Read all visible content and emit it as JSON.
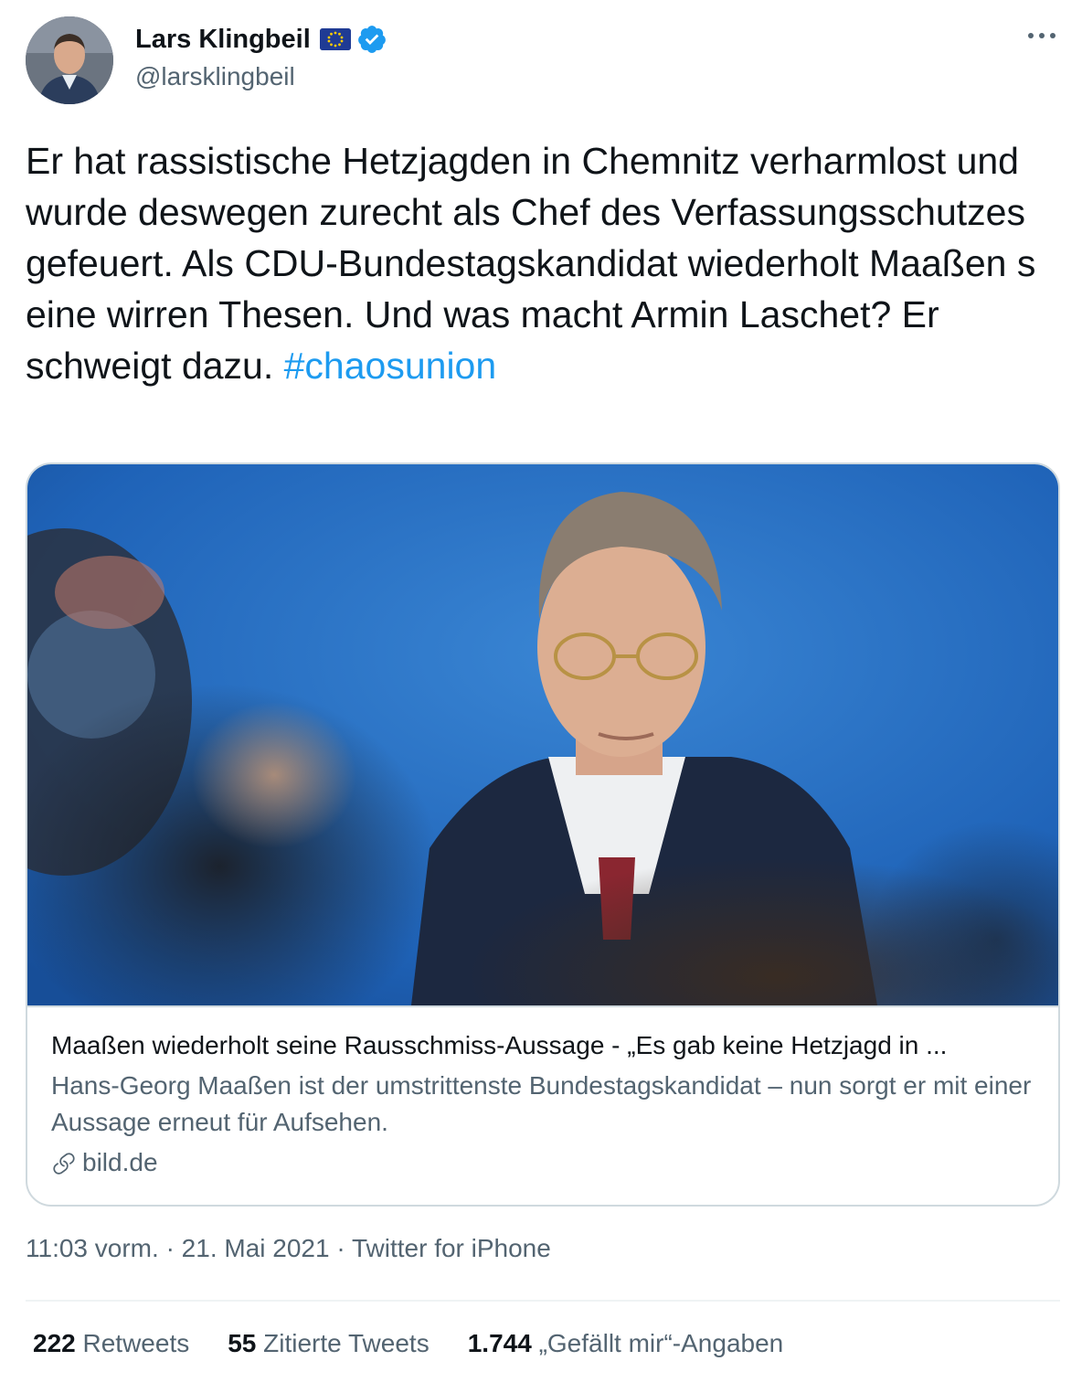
{
  "author": {
    "name": "Lars Klingbeil",
    "handle": "@larsklingbeil"
  },
  "tweet": {
    "text": "Er hat rassistische Hetzjagden in Chemnitz verharmlost und wurde deswegen zurecht als Chef des Verfassungsschutzes gefeuert. Als CDU-Bundestagskandidat wiederholt Maaßen s eine wirren Thesen. Und was macht Armin Laschet? Er schweigt dazu.",
    "hashtag": "#chaosunion"
  },
  "card": {
    "title": "Maaßen wiederholt seine Rausschmiss-Aussage - „Es gab keine Hetzjagd in ...",
    "description": "Hans-Georg Maaßen ist der umstrittenste Bundestagskandidat – nun sorgt er mit einer Aussage erneut für Aufsehen.",
    "domain": "bild.de"
  },
  "meta": {
    "time": "11:03 vorm.",
    "date": "21. Mai 2021",
    "source": "Twitter for iPhone",
    "separator": "·"
  },
  "stats": {
    "retweets": {
      "count": "222",
      "label": "Retweets"
    },
    "quotes": {
      "count": "55",
      "label": "Zitierte Tweets"
    },
    "likes": {
      "count": "1.744",
      "label": "„Gefällt mir“-Angaben"
    }
  },
  "colors": {
    "accent": "#1d9bf0",
    "text": "#0f1419",
    "muted": "#536471",
    "border": "#cfd9de"
  },
  "icons": [
    "eu-flag-icon",
    "verified-badge-icon",
    "more-options-icon",
    "link-icon"
  ]
}
